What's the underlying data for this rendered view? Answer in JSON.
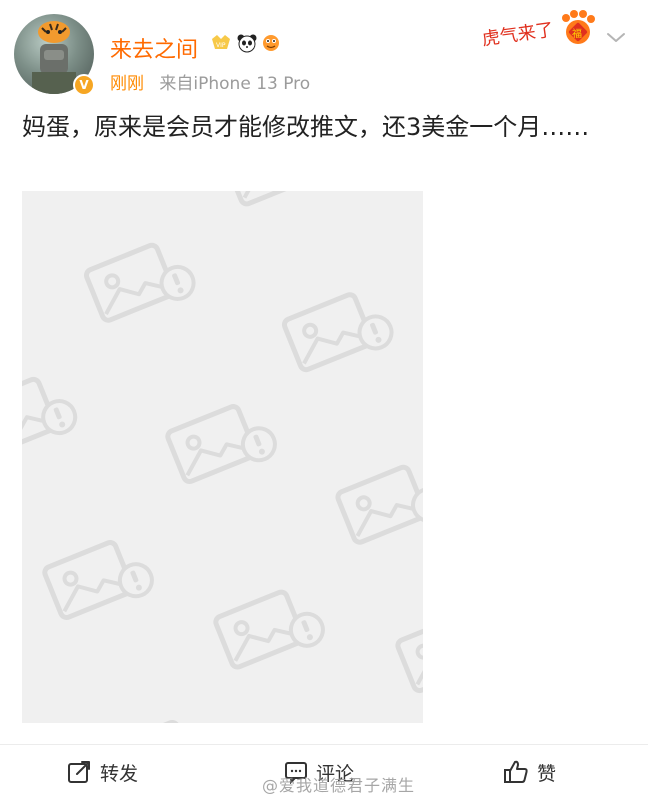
{
  "post": {
    "username": "来去之间",
    "time": "刚刚",
    "source": "来自iPhone 13 Pro",
    "text": "妈蛋，原来是会员才能修改推文，还3美金一个月……",
    "image_state": "image-load-failed"
  },
  "header": {
    "festive_label": "虎气来了",
    "festive_badge_char": "福",
    "vip_label": "VIP",
    "verified_label": "V"
  },
  "actions": {
    "repost_label": "转发",
    "comment_label": "评论",
    "like_label": "赞"
  },
  "watermark": "@爱我道德君子满生",
  "colors": {
    "username": "#ff6a00",
    "time": "#ff8a00",
    "placeholder_bg": "#f0f0f0",
    "placeholder_icon": "#dddddd"
  }
}
